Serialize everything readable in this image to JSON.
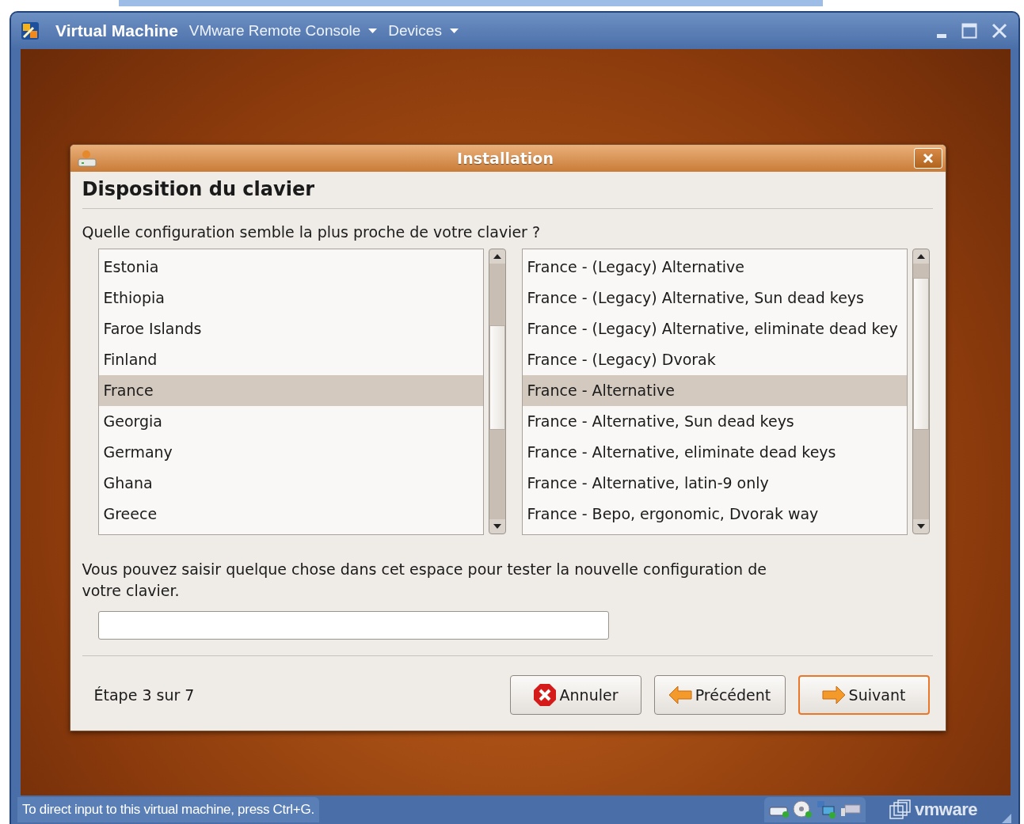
{
  "window": {
    "title": "Virtual Machine",
    "menus": [
      {
        "label": "VMware Remote Console"
      },
      {
        "label": "Devices"
      }
    ]
  },
  "dialog": {
    "title": "Installation",
    "heading": "Disposition du clavier",
    "question": "Quelle configuration semble la plus proche de votre clavier ?",
    "countries": [
      {
        "label": "Estonia",
        "selected": false
      },
      {
        "label": "Ethiopia",
        "selected": false
      },
      {
        "label": "Faroe Islands",
        "selected": false
      },
      {
        "label": "Finland",
        "selected": false
      },
      {
        "label": "France",
        "selected": true
      },
      {
        "label": "Georgia",
        "selected": false
      },
      {
        "label": "Germany",
        "selected": false
      },
      {
        "label": "Ghana",
        "selected": false
      },
      {
        "label": "Greece",
        "selected": false
      }
    ],
    "variants": [
      {
        "label": "France - (Legacy) Alternative",
        "selected": false
      },
      {
        "label": "France - (Legacy) Alternative, Sun dead keys",
        "selected": false
      },
      {
        "label": "France - (Legacy) Alternative, eliminate dead key",
        "selected": false
      },
      {
        "label": "France - (Legacy) Dvorak",
        "selected": false
      },
      {
        "label": "France - Alternative",
        "selected": true
      },
      {
        "label": "France - Alternative, Sun dead keys",
        "selected": false
      },
      {
        "label": "France - Alternative, eliminate dead keys",
        "selected": false
      },
      {
        "label": "France - Alternative, latin-9 only",
        "selected": false
      },
      {
        "label": "France - Bepo, ergonomic, Dvorak way",
        "selected": false
      }
    ],
    "test_prompt": "Vous pouvez saisir quelque chose dans cet espace pour tester la nouvelle configuration de votre clavier.",
    "step": "Étape 3 sur 7",
    "buttons": [
      {
        "label": "Annuler",
        "kind": "cancel",
        "default": false
      },
      {
        "label": "Précédent",
        "kind": "back",
        "default": false
      },
      {
        "label": "Suivant",
        "kind": "next",
        "default": true
      }
    ]
  },
  "status_bar": {
    "text": "To direct input to this virtual machine, press Ctrl+G.",
    "brand": "vmware"
  }
}
